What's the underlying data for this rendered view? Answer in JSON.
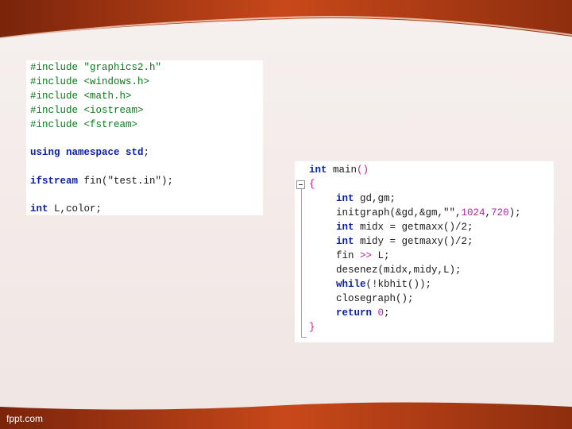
{
  "slide": {
    "colors": {
      "band_dark": "#8a2a0c",
      "band_light": "#d8531c",
      "background": "#f3ecea"
    },
    "footer_brand": "fppt.com"
  },
  "code_left": {
    "lines": [
      {
        "a": "#include",
        "b": " \"graphics2.h\""
      },
      {
        "a": "#include",
        "b": " <windows.h>"
      },
      {
        "a": "#include",
        "b": " <math.h>"
      },
      {
        "a": "#include",
        "b": " <iostream>"
      },
      {
        "a": "#include",
        "b": " <fstream>"
      },
      {
        "a": "using namespace",
        "b": " std",
        "c": ";"
      },
      {
        "a": "ifstream",
        "b": " fin(\"test.in\")",
        "c": ";"
      },
      {
        "a": "int",
        "b": " L,color",
        "c": ";"
      }
    ]
  },
  "code_right": {
    "header": {
      "type": "int",
      "name": " main",
      "paren": "()"
    },
    "open_brace": "{",
    "body": [
      {
        "a": "int",
        "b": " gd,gm;"
      },
      {
        "a": "initgraph",
        "b": "(&gd,&gm,\"\",",
        "n1": "1024",
        "c": ",",
        "n2": "720",
        "d": ");"
      },
      {
        "a": "int",
        "b": " midx = getmaxx",
        "c": "()/2;"
      },
      {
        "a": "int",
        "b": " midy = getmaxy",
        "c": "()/2;"
      },
      {
        "a": "fin",
        "op": " >>",
        "b": " L;"
      },
      {
        "a": "desenez",
        "b": "(midx,midy,L);"
      },
      {
        "a": "while",
        "b": "(!kbhit());"
      },
      {
        "a": "closegraph",
        "b": "();"
      },
      {
        "a": "return",
        "n": " 0",
        "c": ";"
      }
    ],
    "close_brace": "}"
  }
}
